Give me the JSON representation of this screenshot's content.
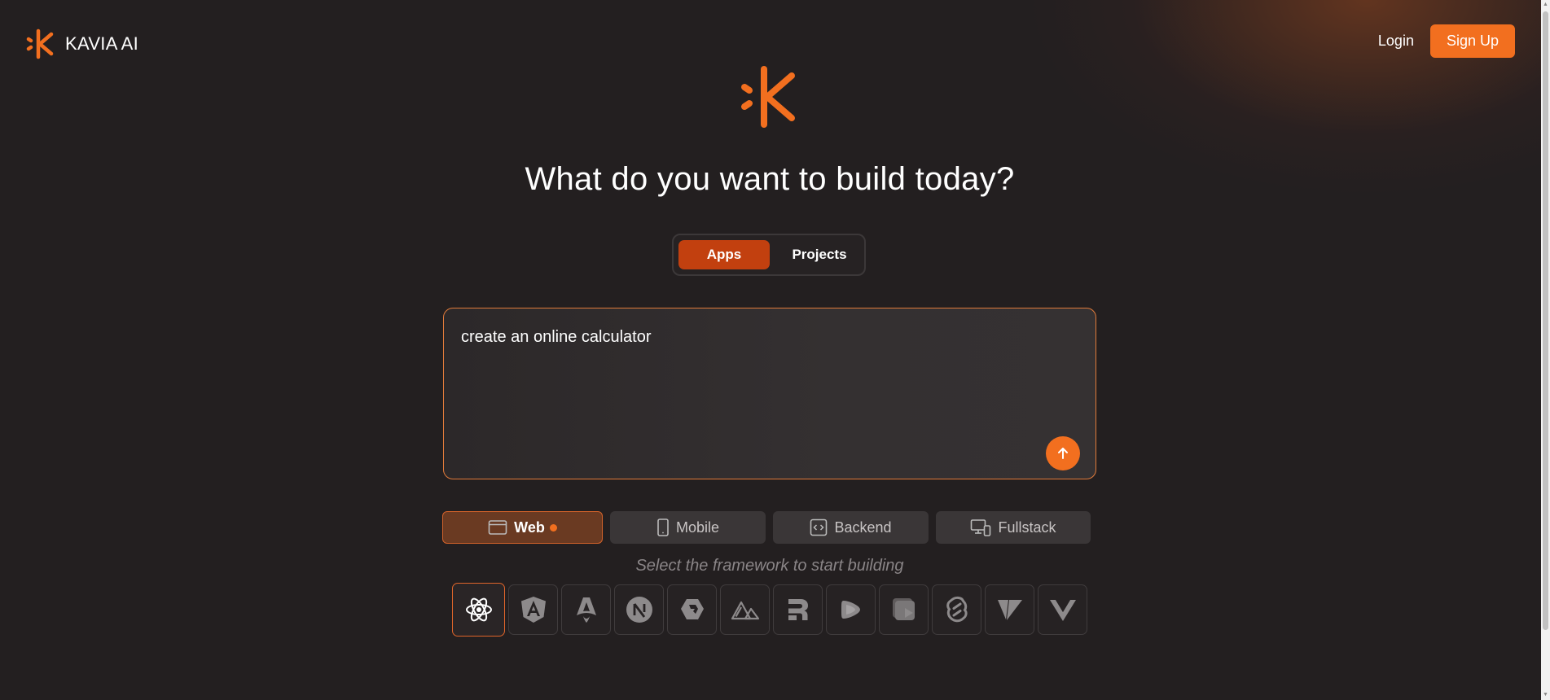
{
  "brand": {
    "name": "KAVIA AI"
  },
  "header": {
    "login_label": "Login",
    "signup_label": "Sign Up"
  },
  "hero": {
    "headline": "What do you want to build today?"
  },
  "mode_toggle": {
    "apps_label": "Apps",
    "projects_label": "Projects",
    "selected": "Apps"
  },
  "prompt": {
    "value": "create an online calculator"
  },
  "platforms": [
    {
      "label": "Web",
      "icon": "browser-window-icon",
      "selected": true
    },
    {
      "label": "Mobile",
      "icon": "smartphone-icon",
      "selected": false
    },
    {
      "label": "Backend",
      "icon": "code-icon",
      "selected": false
    },
    {
      "label": "Fullstack",
      "icon": "devices-icon",
      "selected": false
    }
  ],
  "framework_hint": "Select the framework to start building",
  "frameworks": [
    {
      "icon": "react-icon",
      "selected": true
    },
    {
      "icon": "angular-icon",
      "selected": false
    },
    {
      "icon": "astro-icon",
      "selected": false
    },
    {
      "icon": "nextjs-icon",
      "selected": false
    },
    {
      "icon": "qwik-icon",
      "selected": false
    },
    {
      "icon": "nuxt-icon",
      "selected": false
    },
    {
      "icon": "remix-icon",
      "selected": false
    },
    {
      "icon": "slidev-icon",
      "selected": false
    },
    {
      "icon": "remotion-icon",
      "selected": false
    },
    {
      "icon": "svelte-icon",
      "selected": false
    },
    {
      "icon": "vite-icon",
      "selected": false
    },
    {
      "icon": "vue-icon",
      "selected": false
    }
  ],
  "colors": {
    "accent": "#f26f1f",
    "background": "#231f20",
    "selected_tab": "#c2400f"
  }
}
